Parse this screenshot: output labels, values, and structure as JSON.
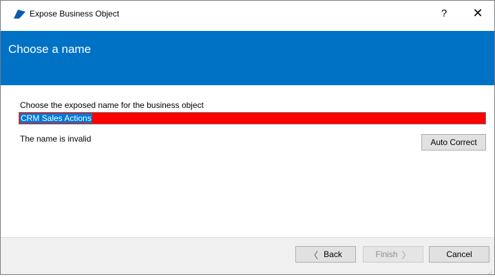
{
  "window": {
    "title": "Expose Business Object",
    "help_label": "?",
    "close_label": "✕"
  },
  "banner": {
    "title": "Choose a name",
    "color": "#0072c6"
  },
  "form": {
    "prompt": "Choose the exposed name for the business object",
    "name_value": "CRM Sales Actions",
    "error_color": "#ff0000",
    "status": "The name is invalid",
    "autocorrect_label": "Auto Correct"
  },
  "footer": {
    "back_label": "Back",
    "finish_label": "Finish",
    "cancel_label": "Cancel",
    "back_chevron": "〈",
    "finish_chevron": "〉",
    "finish_enabled": false
  }
}
